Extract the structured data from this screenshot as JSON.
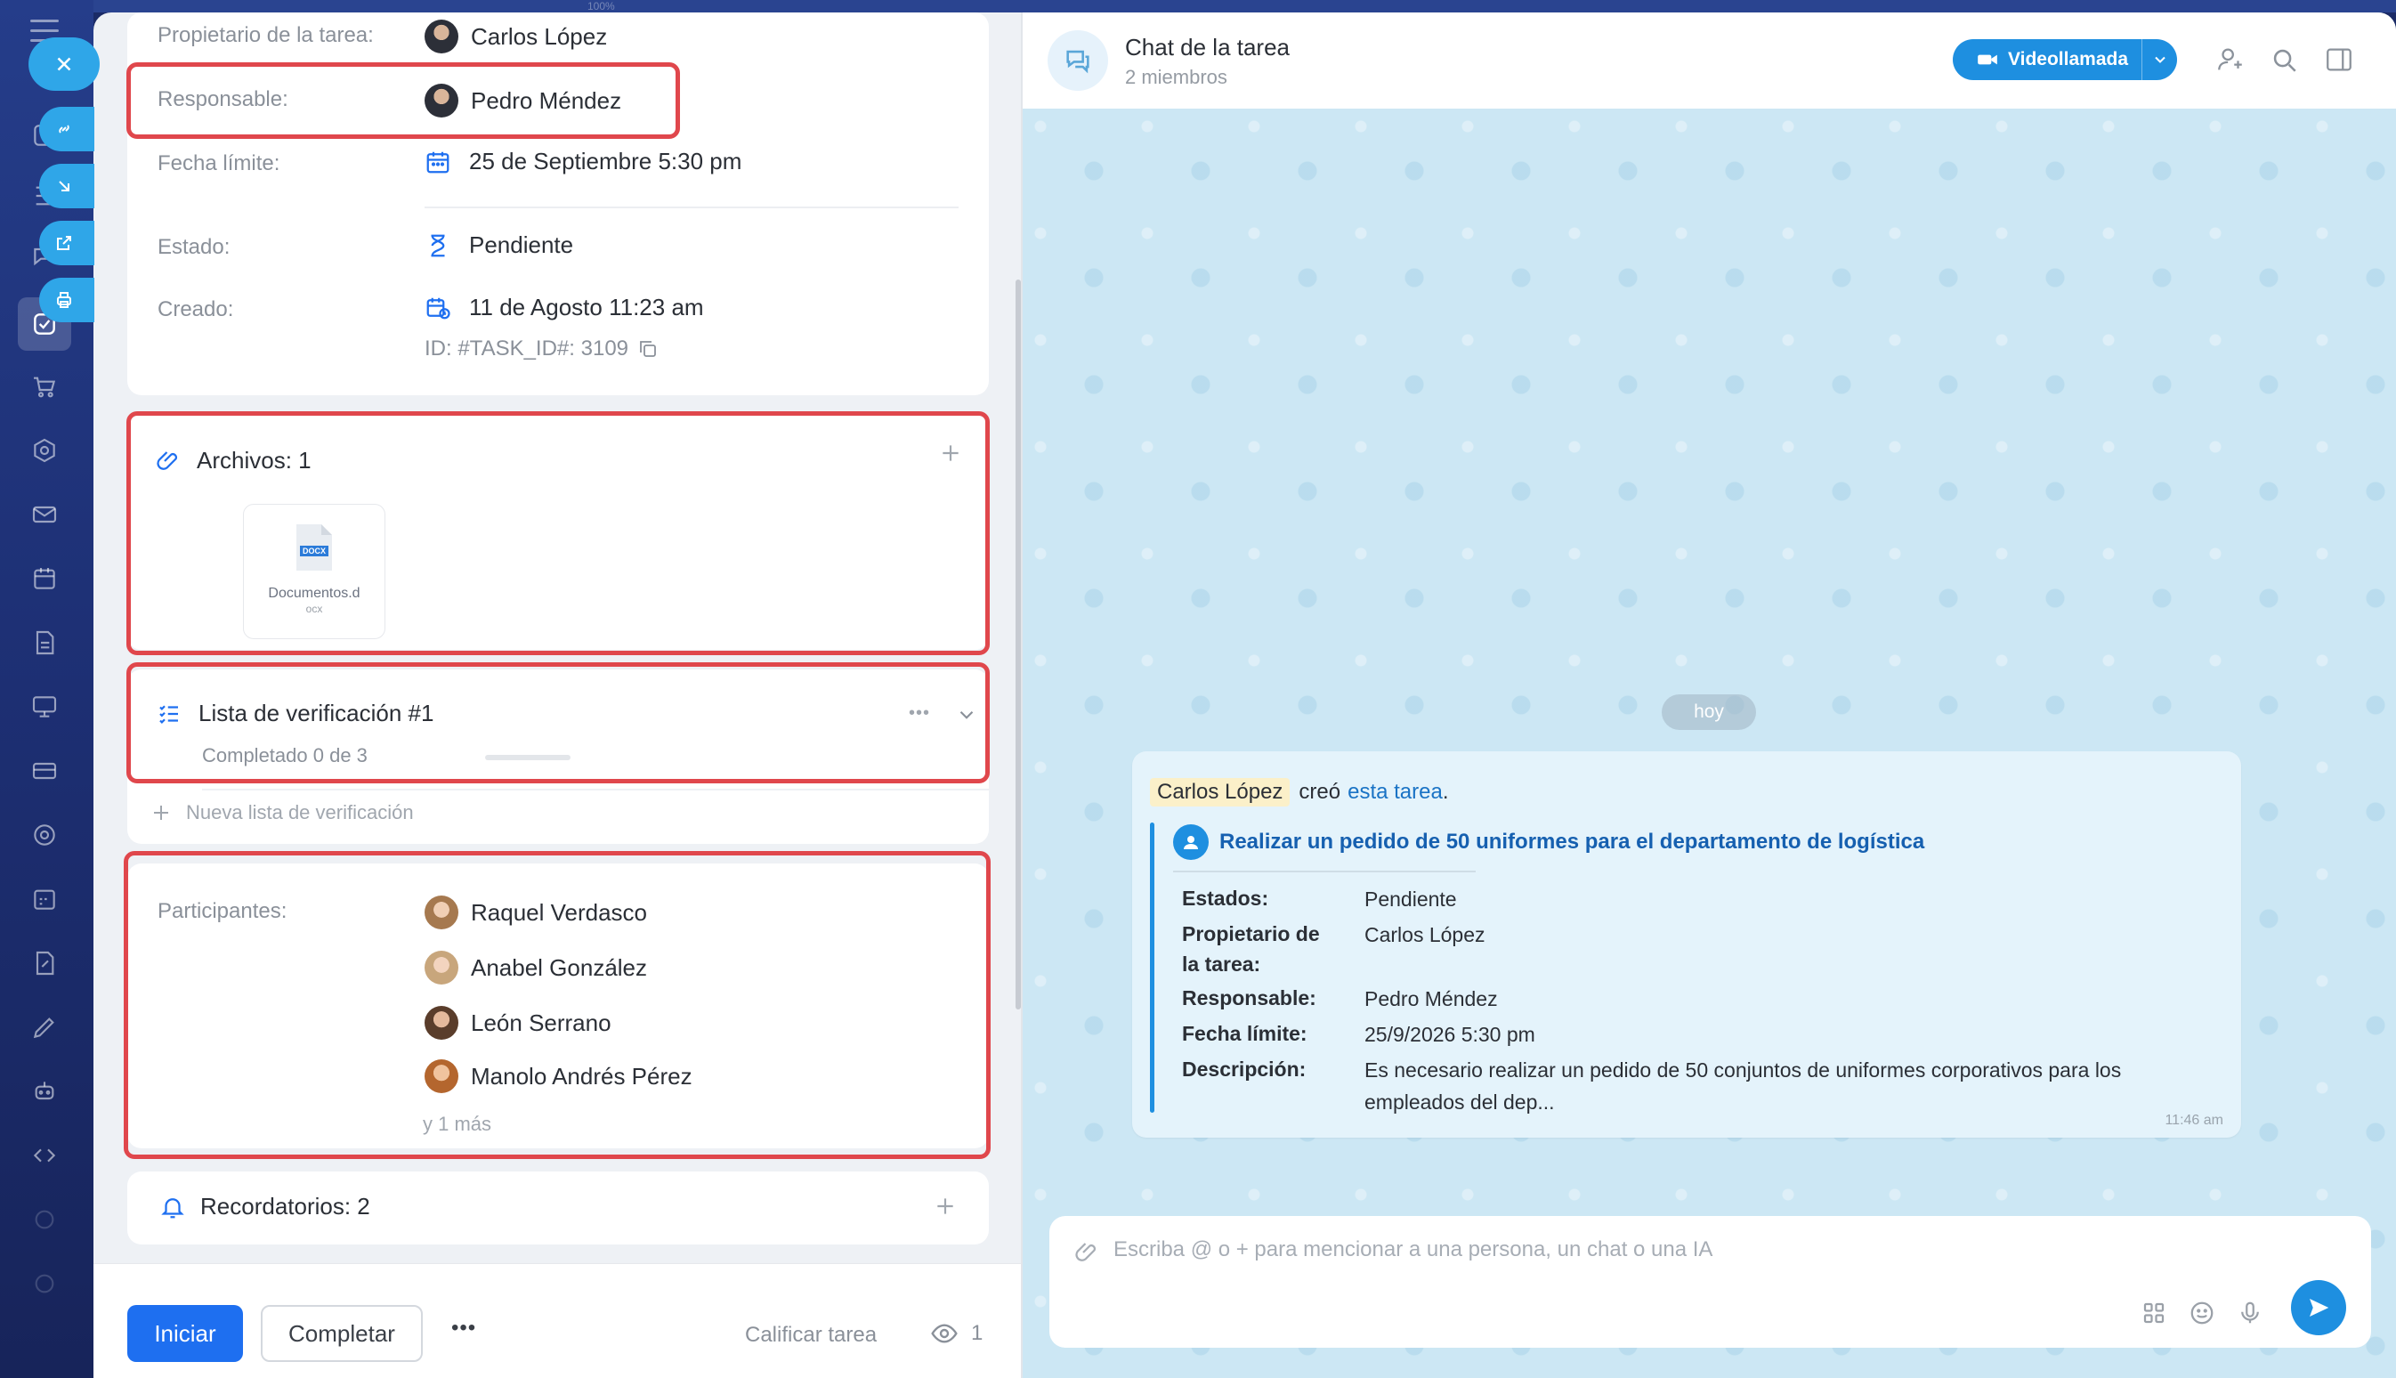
{
  "window": {
    "zoom_text": "100%"
  },
  "task": {
    "owner": {
      "label": "Propietario de la tarea:",
      "value": "Carlos López"
    },
    "responsible": {
      "label": "Responsable:",
      "value": "Pedro Méndez"
    },
    "deadline": {
      "label": "Fecha límite:",
      "value": "25 de Septiembre 5:30 pm"
    },
    "status": {
      "label": "Estado:",
      "value": "Pendiente"
    },
    "created": {
      "label": "Creado:",
      "value": "11 de Agosto 11:23 am"
    },
    "id_text": "ID: #TASK_ID#: 3109",
    "files": {
      "title": "Archivos: 1",
      "items": [
        {
          "name": "Documentos.d",
          "name_rest": "ocx",
          "badge": "DOCX"
        }
      ]
    },
    "checklist": {
      "title": "Lista de verificación #1",
      "progress_text": "Completado 0 de 3",
      "progress_fraction": 0,
      "new_label": "Nueva lista de verificación"
    },
    "participants": {
      "label": "Participantes:",
      "items": [
        {
          "name": "Raquel Verdasco"
        },
        {
          "name": "Anabel González"
        },
        {
          "name": "León Serrano"
        },
        {
          "name": "Manolo Andrés Pérez"
        }
      ],
      "more": "y 1 más"
    },
    "reminders": {
      "title": "Recordatorios: 2"
    },
    "actions": {
      "start": "Iniciar",
      "complete": "Completar",
      "more": "•••",
      "rate": "Calificar tarea",
      "views": "1"
    }
  },
  "chat": {
    "title": "Chat de la tarea",
    "subtitle": "2 miembros",
    "video_button": "Videollamada",
    "date_pill": "hoy",
    "message": {
      "author": "Carlos López",
      "action": "creó",
      "link": "esta tarea",
      "period": ".",
      "task_title": "Realizar un pedido de 50 uniformes para el departamento de logística",
      "fields": [
        {
          "label": "Estados:",
          "value": "Pendiente"
        },
        {
          "label": "Propietario de",
          "label2": "la tarea:",
          "value": "Carlos López"
        },
        {
          "label": "Responsable:",
          "value": "Pedro Méndez"
        },
        {
          "label": "Fecha límite:",
          "value": "25/9/2026 5:30 pm"
        },
        {
          "label": "Descripción:",
          "value": "Es necesario realizar un pedido de 50 conjuntos de uniformes corporativos para los",
          "value2": "empleados del dep..."
        }
      ],
      "time": "11:46 am"
    },
    "composer": {
      "placeholder": "Escriba @ o + para mencionar a una persona, un chat o una IA"
    }
  },
  "colors": {
    "accent": "#1e6ff0",
    "highlight": "#e0474c",
    "chat_bg": "#cce7f4"
  }
}
